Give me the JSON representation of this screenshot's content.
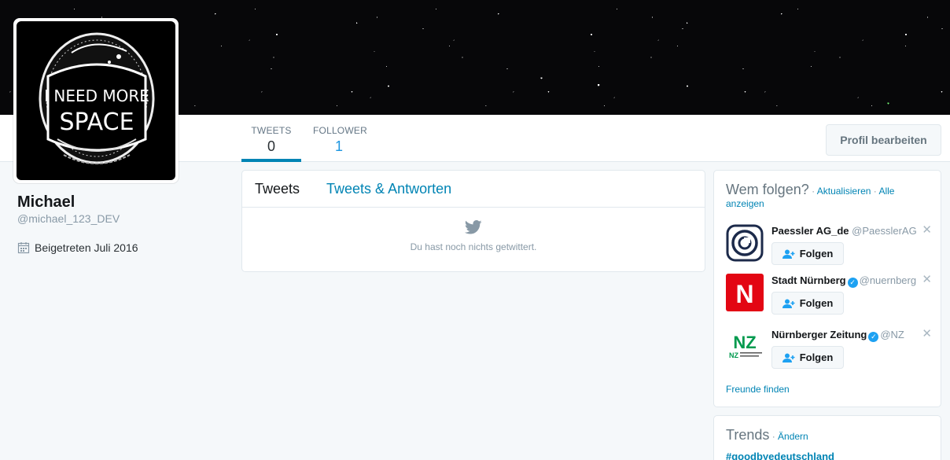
{
  "profile": {
    "name": "Michael",
    "handle": "@michael_123_DEV",
    "joined": "Beigetreten Juli 2016",
    "avatar_text_line1": "I NEED MORE",
    "avatar_text_line2": "SPACE"
  },
  "stats": {
    "tweets_label": "TWEETS",
    "tweets_value": "0",
    "follower_label": "FOLLOWER",
    "follower_value": "1"
  },
  "edit_profile_label": "Profil bearbeiten",
  "timeline": {
    "tab_tweets": "Tweets",
    "tab_replies": "Tweets & Antworten",
    "empty_message": "Du hast noch nichts getwittert."
  },
  "who_to_follow": {
    "title": "Wem folgen?",
    "separator": " · ",
    "refresh": "Aktualisieren",
    "view_all": "Alle anzeigen",
    "follow_label": "Folgen",
    "suggestions": [
      {
        "name": "Paessler AG_de",
        "handle": "@PaesslerAG",
        "verified": false
      },
      {
        "name": "Stadt Nürnberg",
        "handle": "@nuernberg",
        "verified": true
      },
      {
        "name": "Nürnberger Zeitung",
        "handle": "@NZ",
        "verified": true
      }
    ],
    "find_friends": "Freunde finden"
  },
  "trends": {
    "title": "Trends",
    "separator": " · ",
    "change": "Ändern",
    "items": [
      "#goodbyedeutschland"
    ]
  },
  "colors": {
    "link": "#0084b4",
    "accent": "#1da1f2",
    "nuernberg_red": "#e30613",
    "nz_green": "#009a4e",
    "paessler_navy": "#1c2a4a"
  }
}
